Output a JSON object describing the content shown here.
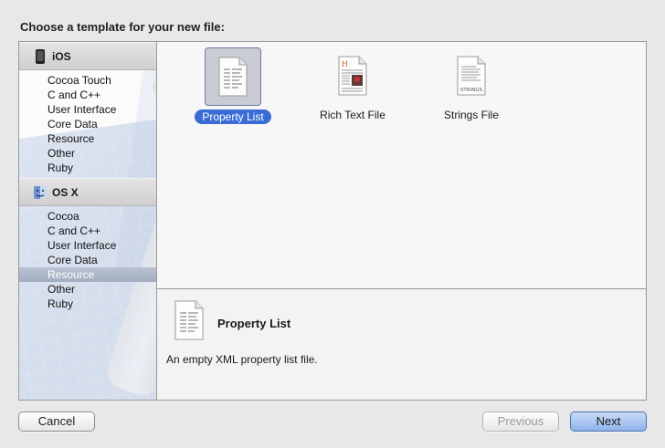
{
  "dialog": {
    "title": "Choose a template for your new file:"
  },
  "sidebar": {
    "groups": [
      {
        "label": "iOS",
        "icon": "iphone-icon",
        "items": [
          "Cocoa Touch",
          "C and C++",
          "User Interface",
          "Core Data",
          "Resource",
          "Other",
          "Ruby"
        ]
      },
      {
        "label": "OS X",
        "icon": "finder-icon",
        "items": [
          "Cocoa",
          "C and C++",
          "User Interface",
          "Core Data",
          "Resource",
          "Other",
          "Ruby"
        ]
      }
    ],
    "selected": "OS X / Resource"
  },
  "templates": [
    {
      "label": "Property List",
      "icon": "property-list-file-icon",
      "selected": true
    },
    {
      "label": "Rich Text File",
      "icon": "rich-text-file-icon",
      "selected": false
    },
    {
      "label": "Strings File",
      "icon": "strings-file-icon",
      "selected": false,
      "icon_text": "STRINGS"
    }
  ],
  "detail": {
    "name": "Property List",
    "description": "An empty XML property list file.",
    "icon": "property-list-file-icon"
  },
  "buttons": {
    "cancel": "Cancel",
    "previous": "Previous",
    "next": "Next"
  },
  "colors": {
    "selection_blue": "#3a6cd6",
    "sidebar_selected": "#a3aec3"
  }
}
